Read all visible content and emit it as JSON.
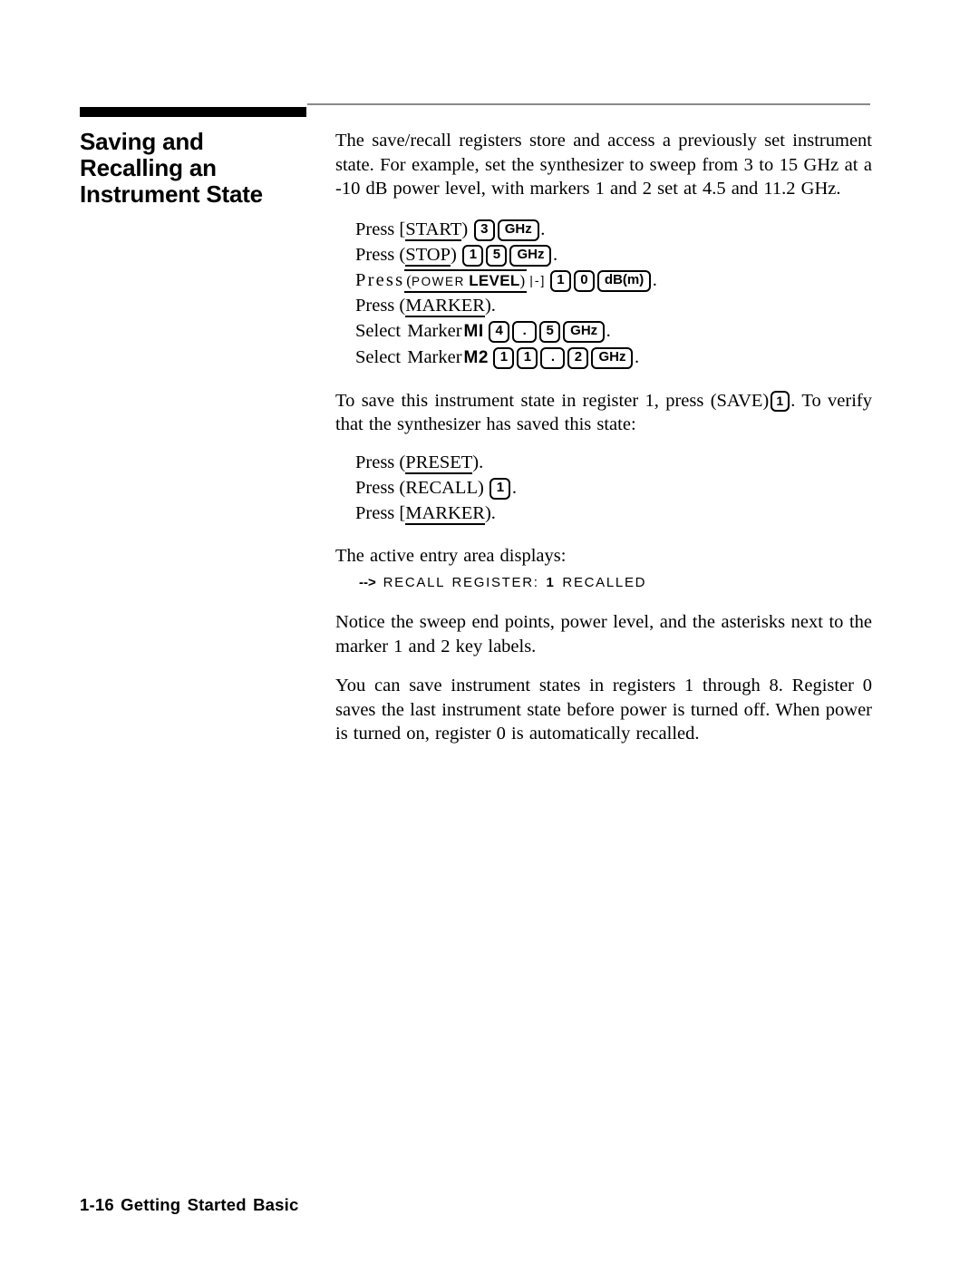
{
  "page": {
    "heading_lines": [
      "Saving and",
      "Recalling an",
      "Instrument State"
    ],
    "footer": "1-16 Getting Started Basic"
  },
  "intro": {
    "text": "The save/recall registers store and access a previously set instrument state. For example, set the synthesizer to sweep from 3 to 15 GHz at a -10 dB power level, with markers 1 and 2 set at 4.5 and 11.2 GHz."
  },
  "steps_setup": {
    "start": {
      "lead": "Press",
      "key": "START",
      "open": "[",
      "close": ")",
      "caps": [
        "3",
        "GHz"
      ],
      "period": "."
    },
    "stop": {
      "lead": "Press",
      "key": "STOP",
      "open": "(",
      "close": ")",
      "caps": [
        "1",
        "5",
        "GHz"
      ],
      "period": "."
    },
    "power": {
      "lead": "Press",
      "soft_open": "(",
      "soft_small": "POWER",
      "soft_bold": "LEVEL",
      "soft_close": ")",
      "minus": "|-]",
      "caps": [
        "1",
        "0",
        "dB(m)"
      ],
      "period": "."
    },
    "marker": {
      "lead": "Press",
      "key": "MARKER",
      "open": "(",
      "close": ")",
      "period": "."
    },
    "marker1": {
      "lead": "Select Marker",
      "label": "MI",
      "caps": [
        "4",
        ".",
        "5",
        "GHz"
      ],
      "period": "."
    },
    "marker2": {
      "lead": "Select Marker",
      "label": "M2",
      "caps": [
        "1",
        "1",
        ".",
        "2",
        "GHz"
      ],
      "period": "."
    }
  },
  "save_para": {
    "before": "To save this instrument state in register 1, press (SAVE)",
    "cap": "1",
    "after": ". To verify that the synthesizer has saved this state:"
  },
  "steps_verify": {
    "preset": {
      "lead": "Press",
      "key": "PRESET",
      "open": "(",
      "close": ")",
      "period": "."
    },
    "recall": {
      "lead": "Press",
      "key": "RECALL",
      "open": "(",
      "close": ")",
      "cap": "1",
      "period": "."
    },
    "marker": {
      "lead": "Press",
      "key": "MARKER",
      "open": "[",
      "close": ")",
      "period": "."
    }
  },
  "display": {
    "intro": "The active entry area displays:",
    "arrow": "-->",
    "text_before": " RECALL REGISTER: ",
    "register": "1",
    "text_after": " RECALLED"
  },
  "notice_para": {
    "text": "Notice the sweep end points, power level, and the asterisks next to the marker 1 and 2 key labels."
  },
  "registers_para": {
    "text": "You can save instrument states in registers 1 through 8. Register 0 saves the last instrument state before power is turned off. When power is turned on, register 0 is automatically recalled."
  }
}
